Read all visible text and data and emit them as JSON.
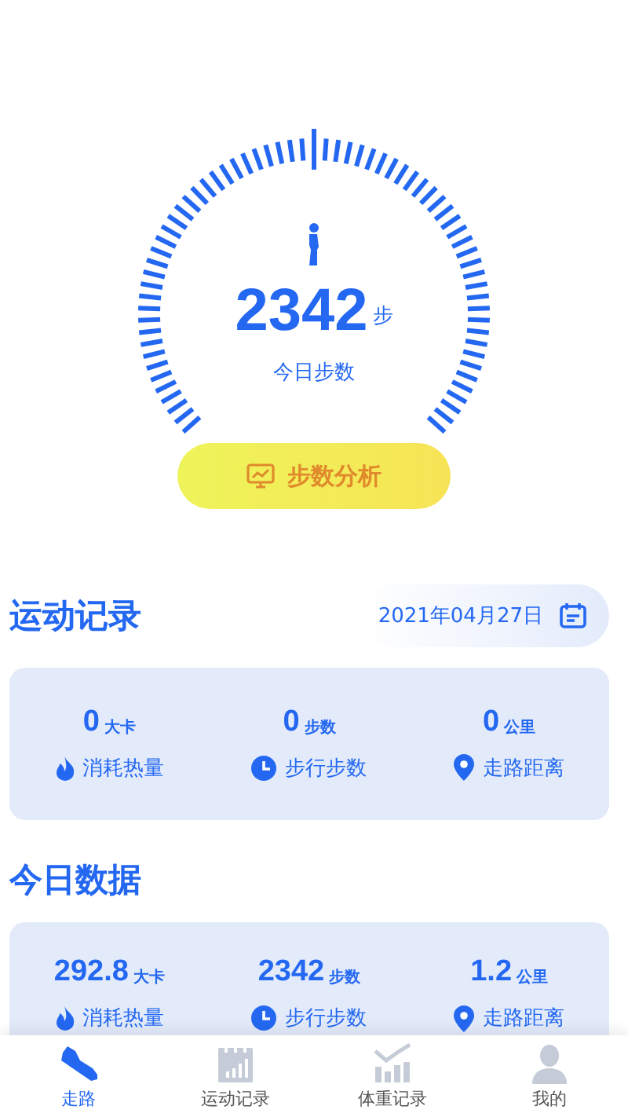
{
  "gauge": {
    "steps": "2342",
    "unit": "步",
    "label": "今日步数"
  },
  "analysis_button": {
    "label": "步数分析"
  },
  "sport_record": {
    "title": "运动记录",
    "date": "2021年04月27日",
    "stats": [
      {
        "kind": "calories",
        "value": "0",
        "unit": "大卡",
        "label": "消耗热量"
      },
      {
        "kind": "steps",
        "value": "0",
        "unit": "步数",
        "label": "步行步数"
      },
      {
        "kind": "distance",
        "value": "0",
        "unit": "公里",
        "label": "走路距离"
      }
    ]
  },
  "today_data": {
    "title": "今日数据",
    "stats": [
      {
        "kind": "calories",
        "value": "292.8",
        "unit": "大卡",
        "label": "消耗热量"
      },
      {
        "kind": "steps",
        "value": "2342",
        "unit": "步数",
        "label": "步行步数"
      },
      {
        "kind": "distance",
        "value": "1.2",
        "unit": "公里",
        "label": "走路距离"
      }
    ]
  },
  "tab_bar": [
    {
      "kind": "walk",
      "label": "走路",
      "selected": true
    },
    {
      "kind": "record",
      "label": "运动记录",
      "selected": false
    },
    {
      "kind": "weight",
      "label": "体重记录",
      "selected": false
    },
    {
      "kind": "me",
      "label": "我的",
      "selected": false
    }
  ]
}
